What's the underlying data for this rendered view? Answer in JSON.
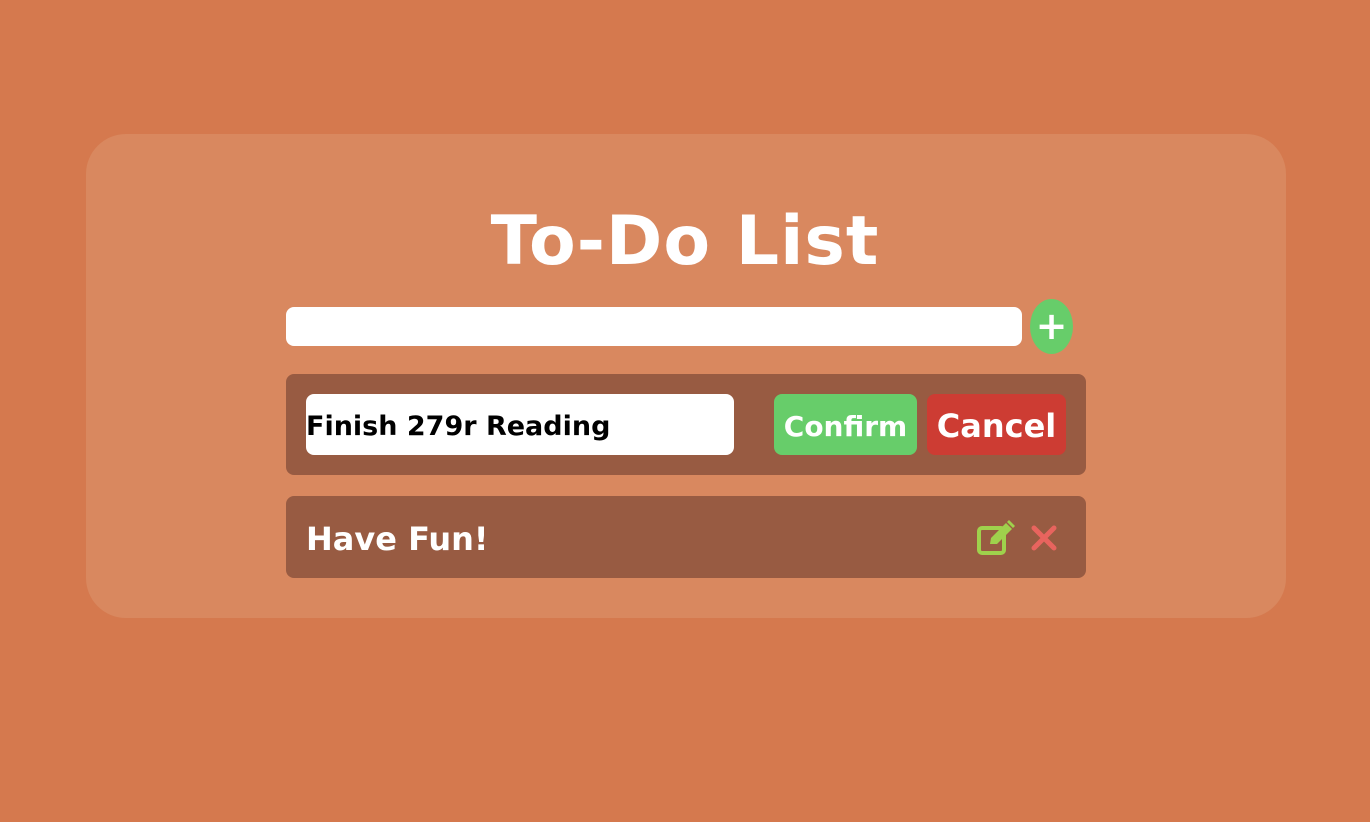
{
  "app": {
    "title": "To-Do List"
  },
  "new_task": {
    "value": "",
    "add_icon": "plus-icon"
  },
  "editing_task": {
    "value": "Finish 279r Reading",
    "confirm_label": "Confirm",
    "cancel_label": "Cancel"
  },
  "tasks": [
    {
      "label": "Have Fun!",
      "edit_icon": "pencil-square-icon",
      "delete_icon": "close-icon"
    }
  ],
  "colors": {
    "background": "#d5794e",
    "card": "#d9885f",
    "row": "#985b42",
    "accent_green": "#67cd6a",
    "cancel_red": "#cd3c33",
    "edit_icon_green": "#9fd14c",
    "delete_icon_red": "#e8645e"
  }
}
